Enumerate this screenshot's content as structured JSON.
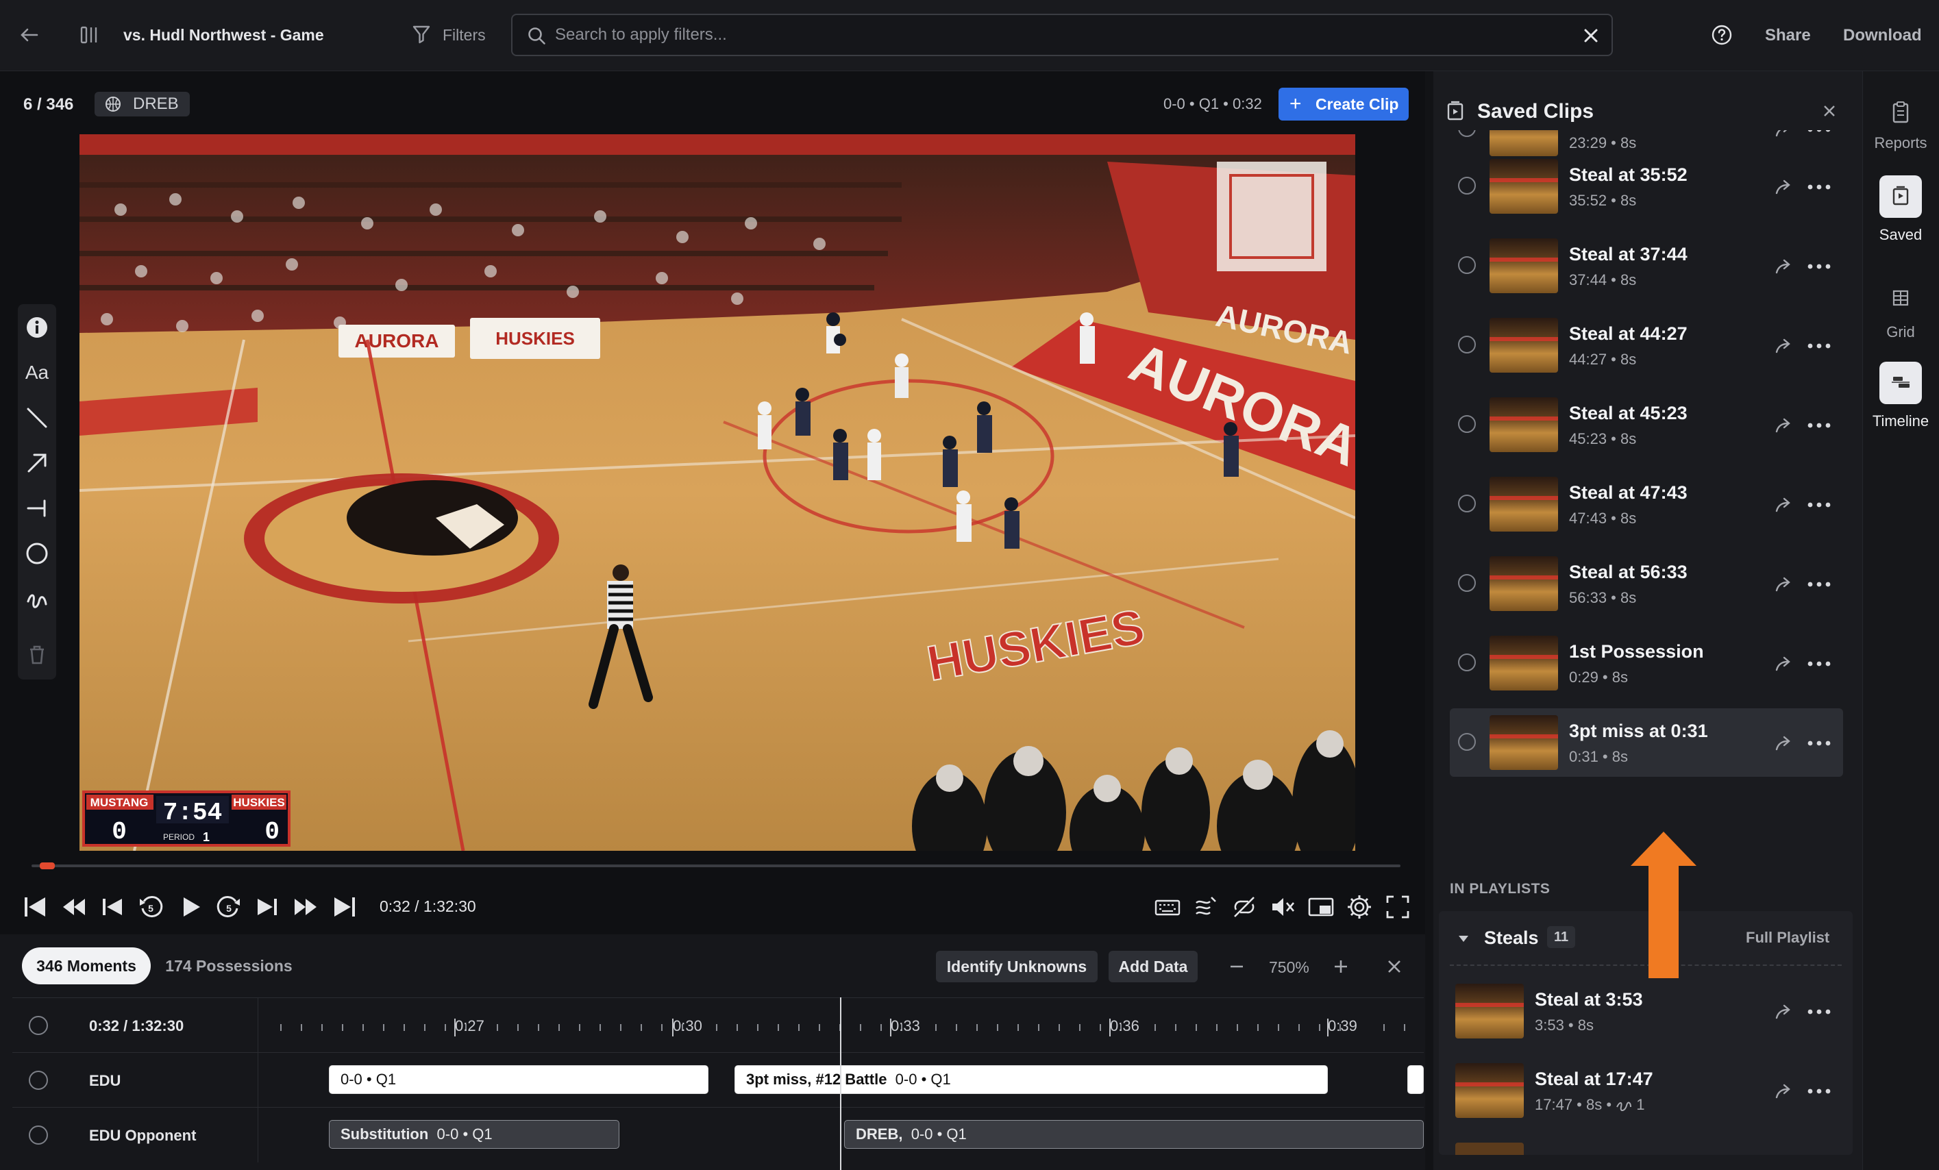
{
  "header": {
    "title": "vs. Hudl Northwest - Game",
    "filters_label": "Filters",
    "search_placeholder": "Search to apply filters...",
    "share_label": "Share",
    "download_label": "Download"
  },
  "player": {
    "counter": "6 / 346",
    "badge_label": "DREB",
    "game_context": "0-0 • Q1 • 0:32",
    "create_clip_label": "Create Clip",
    "time": "0:32 / 1:32:30",
    "progress": 0.006,
    "scoreboard": {
      "home": "MUSTANG",
      "home_score": "0",
      "clock": "7:54",
      "period_label": "PERIOD",
      "period": "1",
      "away": "HUSKIES",
      "away_score": "0"
    },
    "banners": {
      "left": "AURORA",
      "right": "HUSKIES",
      "wall": "AURORA",
      "floor": "HUSKIES",
      "court_top": "AURORA"
    }
  },
  "tools": [
    "info-icon",
    "text-icon",
    "line-icon",
    "arrow-icon",
    "t-line-icon",
    "circle-icon",
    "freehand-icon",
    "trash-icon"
  ],
  "timeline": {
    "tabs": [
      {
        "label": "346 Moments",
        "active": true
      },
      {
        "label": "174 Possessions",
        "active": false
      }
    ],
    "identify_label": "Identify Unknowns",
    "add_data_label": "Add Data",
    "zoom": "750%",
    "header_time": "0:32 / 1:32:30",
    "ticks": [
      "0:27",
      "0:30",
      "0:33",
      "0:36",
      "0:39"
    ],
    "rows": [
      {
        "label": "EDU",
        "clips": [
          {
            "title": "",
            "meta": "0-0 • Q1"
          },
          {
            "title": "3pt miss, #12 Battle",
            "meta": "0-0 • Q1"
          }
        ]
      },
      {
        "label": "EDU Opponent",
        "clips": [
          {
            "title": "Substitution",
            "meta": "0-0 • Q1"
          },
          {
            "title": "DREB,",
            "meta": "0-0 • Q1"
          }
        ]
      }
    ]
  },
  "saved": {
    "title": "Saved Clips",
    "clips": [
      {
        "title": "",
        "meta": "23:29 • 8s"
      },
      {
        "title": "Steal at 35:52",
        "meta": "35:52 • 8s"
      },
      {
        "title": "Steal at 37:44",
        "meta": "37:44 • 8s"
      },
      {
        "title": "Steal at 44:27",
        "meta": "44:27 • 8s"
      },
      {
        "title": "Steal at 45:23",
        "meta": "45:23 • 8s"
      },
      {
        "title": "Steal at 47:43",
        "meta": "47:43 • 8s"
      },
      {
        "title": "Steal at 56:33",
        "meta": "56:33 • 8s"
      },
      {
        "title": "1st Possession",
        "meta": "0:29 • 8s"
      },
      {
        "title": "3pt miss at 0:31",
        "meta": "0:31 • 8s",
        "highlighted": true
      }
    ],
    "in_playlists_label": "IN PLAYLISTS",
    "playlist": {
      "name": "Steals",
      "count": "11",
      "full_label": "Full Playlist",
      "clips": [
        {
          "title": "Steal at 3:53",
          "meta": "3:53 • 8s"
        },
        {
          "title": "Steal at 17:47",
          "meta": "17:47 • 8s •",
          "annotation_count": "1"
        }
      ]
    },
    "arrow_color": "#f07a22"
  },
  "rail": [
    {
      "label": "Reports",
      "icon": "clipboard-icon",
      "active": false
    },
    {
      "label": "Saved",
      "icon": "saved-icon",
      "active": true
    },
    {
      "label": "Grid",
      "icon": "grid-icon",
      "active": false
    },
    {
      "label": "Timeline",
      "icon": "timeline-icon",
      "active": true
    }
  ],
  "colors": {
    "accent": "#2f6fe6",
    "progress": "#e24a2f",
    "arrow": "#f07a22"
  }
}
